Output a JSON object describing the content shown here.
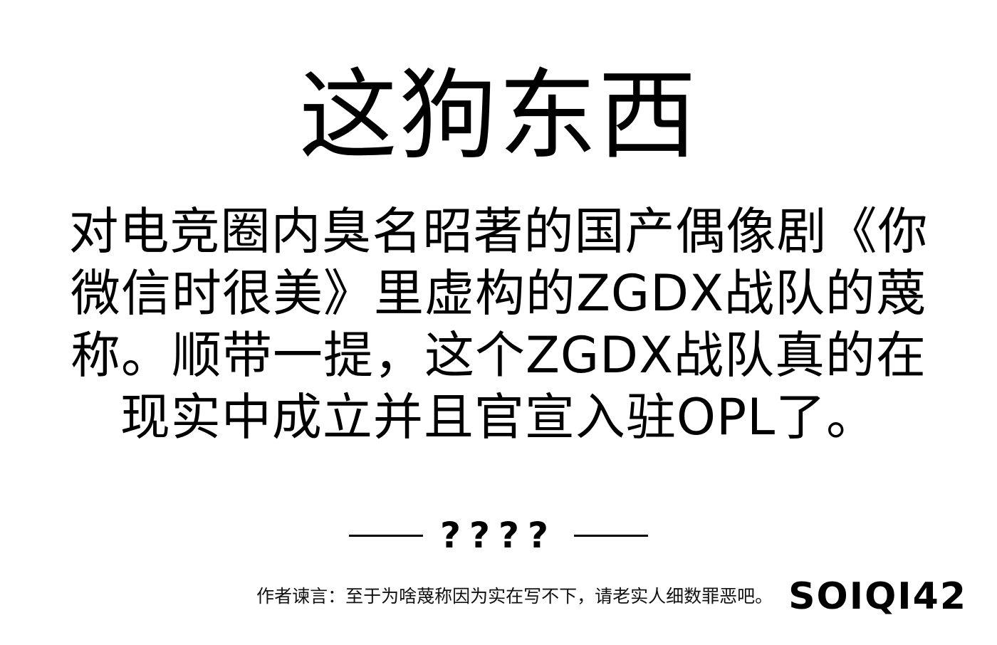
{
  "title": "这狗东西",
  "body_lines": [
    "对电竞圈内臭名昭著的国产偶像剧《你",
    "微信时很美》里虚构的ZGDX战队的蔑",
    "称。顺带一提，这个ZGDX战队真的在",
    "现实中成立并且官宣入驻OPL了。"
  ],
  "signature": "????",
  "footer": {
    "note": "作者谏言：至于为啥蔑称因为实在写不下，请老实人细数罪恶吧。",
    "code": "SOIQI42"
  }
}
